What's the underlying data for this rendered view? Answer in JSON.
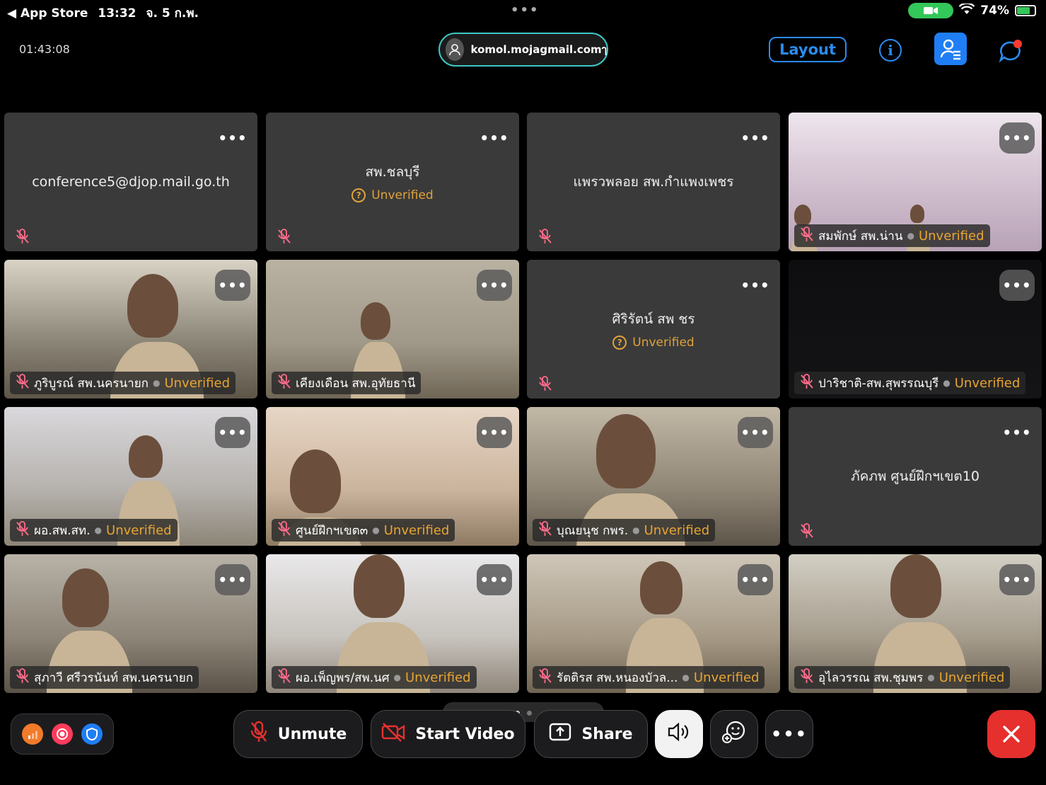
{
  "status_bar": {
    "back_app": "◀ App Store",
    "time": "13:32",
    "date": "จ. 5 ก.พ.",
    "battery": "74%",
    "battery_level": 0.74
  },
  "top_bar": {
    "duration": "01:43:08",
    "host": "komol.mojagmail.comๅ",
    "layout_label": "Layout"
  },
  "tiles": [
    {
      "name": "conference5@djop.mail.go.th",
      "unverified": "",
      "has_video": false
    },
    {
      "name": "สพ.ชลบุรี",
      "unverified": "Unverified",
      "has_video": false
    },
    {
      "name": "แพรวพลอย สพ.กำแพงเพชร",
      "unverified": "",
      "has_video": false
    },
    {
      "name": "สมพักษ์ สพ.น่าน",
      "unverified": "Unverified",
      "has_video": true
    },
    {
      "name": "ภูริบูรณ์ สพ.นครนายก",
      "unverified": "Unverified",
      "has_video": true
    },
    {
      "name": "เคียงเดือน สพ.อุทัยธานี",
      "unverified": "",
      "has_video": true
    },
    {
      "name": "ศิริรัตน์ สพ  ชร",
      "unverified": "Unverified",
      "has_video": false
    },
    {
      "name": "ปาริชาติ-สพ.สุพรรณบุรี",
      "unverified": "Unverified",
      "has_video": true
    },
    {
      "name": "ผอ.สพ.สท.",
      "unverified": "Unverified",
      "has_video": true
    },
    {
      "name": "ศูนย์ฝึกฯเขต๓",
      "unverified": "Unverified",
      "has_video": true
    },
    {
      "name": "บุณยนุช กพร.",
      "unverified": "Unverified",
      "has_video": true
    },
    {
      "name": "ภัคภพ ศูนย์ฝึกฯเขต10",
      "unverified": "",
      "has_video": false
    },
    {
      "name": "สุภาวี ศรีวรนันท์ สพ.นครนายก",
      "unverified": "",
      "has_video": true
    },
    {
      "name": "ผอ.เพ็ญพร/สพ.นศ",
      "unverified": "Unverified",
      "has_video": true
    },
    {
      "name": "รัตติรส สพ.หนองบัวล...",
      "unverified": "Unverified",
      "has_video": true
    },
    {
      "name": "อุไลวรรณ สพ.ชุมพร",
      "unverified": "Unverified",
      "has_video": true
    }
  ],
  "controls": {
    "unmute": "Unmute",
    "start_video": "Start Video",
    "share": "Share"
  },
  "more_glyph": "•••",
  "colors": {
    "accent": "#2a8cf0",
    "unverified": "#e8a532",
    "end": "#e5302e",
    "host_border": "#3ec6c6"
  }
}
